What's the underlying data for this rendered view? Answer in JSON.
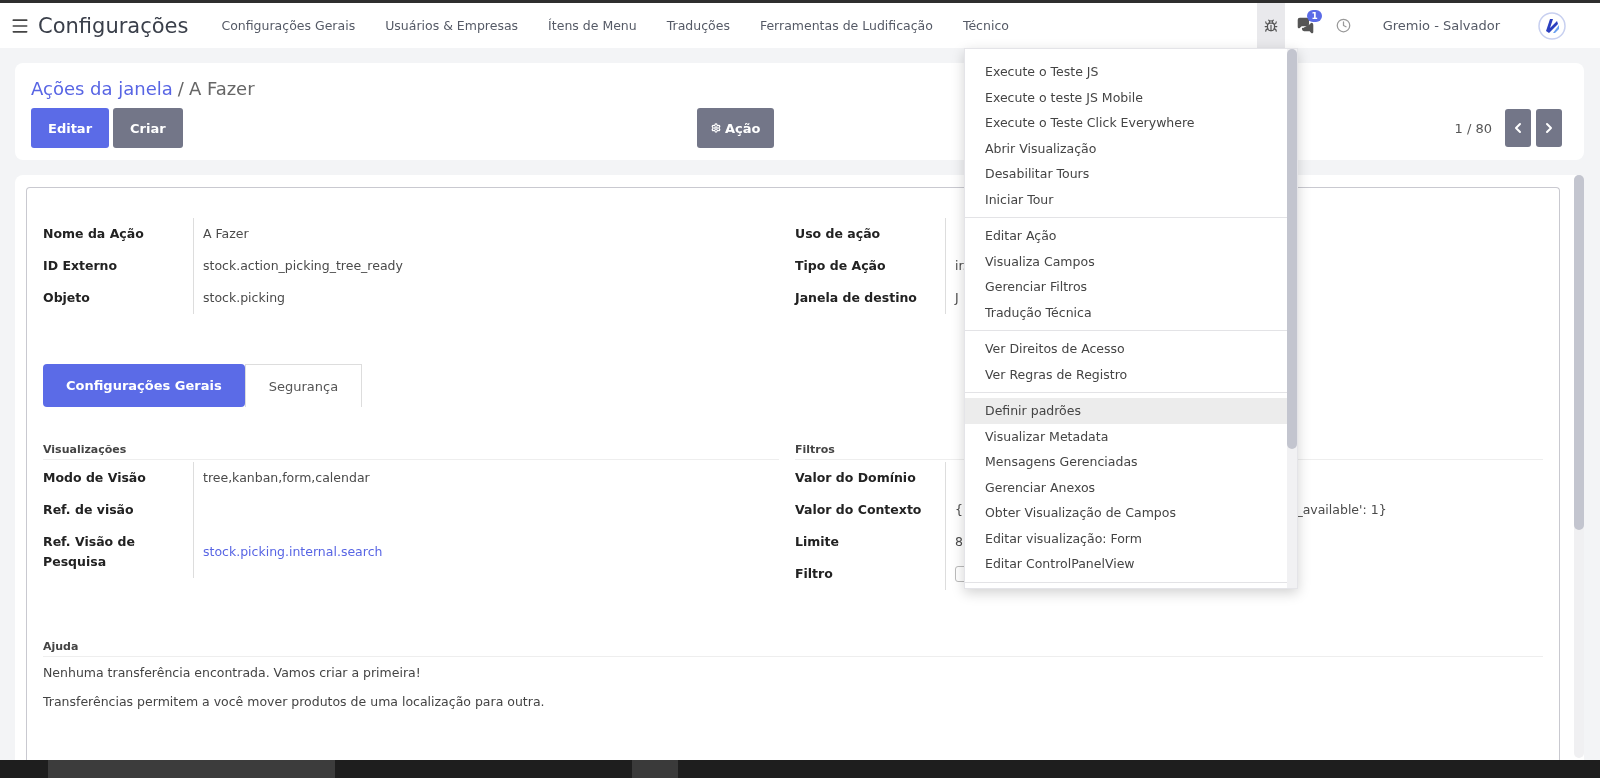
{
  "navbar": {
    "app_title": "Configurações",
    "menu": [
      "Configurações Gerais",
      "Usuários & Empresas",
      "Ítens de Menu",
      "Traduções",
      "Ferramentas de Ludificação",
      "Técnico"
    ],
    "debug_menu_open": true,
    "messages_badge": "1",
    "user": "Gremio - Salvador"
  },
  "control_panel": {
    "breadcrumb": [
      {
        "label": "Ações da janela",
        "link": true
      },
      {
        "label": "A Fazer",
        "link": false
      }
    ],
    "separator": "/",
    "buttons": [
      {
        "label": "Editar",
        "kind": "primary"
      },
      {
        "label": "Criar",
        "kind": "secondary"
      }
    ],
    "action_button": "Ação",
    "pager": "1 / 80"
  },
  "form": {
    "top_left": [
      {
        "label": "Nome da Ação",
        "value": "A Fazer",
        "kind": "text"
      },
      {
        "label": "ID Externo",
        "value": "stock.action_picking_tree_ready",
        "kind": "text"
      },
      {
        "label": "Objeto",
        "value": "stock.picking",
        "kind": "text"
      }
    ],
    "top_right": [
      {
        "label": "Uso de ação",
        "kind": "empty"
      },
      {
        "label": "Tipo de Ação",
        "value": "ir.",
        "kind": "text"
      },
      {
        "label": "Janela de destino",
        "value": "J",
        "kind": "text"
      }
    ],
    "tabs": [
      {
        "label": "Configurações Gerais",
        "selected": true
      },
      {
        "label": "Segurança",
        "selected": false
      }
    ],
    "sections": [
      {
        "title": "Visualizações",
        "fields": [
          {
            "label": "Modo de Visão",
            "value": "tree,kanban,form,calendar",
            "kind": "text"
          },
          {
            "label": "Ref. de visão",
            "kind": "empty"
          },
          {
            "label": "Ref. Visão de Pesquisa",
            "value": "stock.picking.internal.search",
            "kind": "link"
          }
        ]
      },
      {
        "title": "Filtros",
        "fields": [
          {
            "label": "Valor do Domínio",
            "kind": "empty"
          },
          {
            "label": "Valor do Contexto",
            "kind": "split",
            "value_parts": [
              "{'",
              "_available': 1}"
            ]
          },
          {
            "label": "Limite",
            "value": "8",
            "kind": "text"
          },
          {
            "label": "Filtro",
            "kind": "checkbox",
            "checked": false
          }
        ]
      }
    ],
    "help": {
      "title": "Ajuda",
      "paragraphs": [
        "Nenhuma transferência encontrada. Vamos criar a primeira!",
        "Transferências permitem a você mover produtos de uma localização para outra."
      ]
    }
  },
  "debug_menu": {
    "groups": [
      [
        {
          "label": "Execute o Teste JS",
          "highlighted": false
        },
        {
          "label": "Execute o teste JS Mobile",
          "highlighted": false
        },
        {
          "label": "Execute o Teste Click Everywhere",
          "highlighted": false
        },
        {
          "label": "Abrir Visualização",
          "highlighted": false
        },
        {
          "label": "Desabilitar Tours",
          "highlighted": false
        },
        {
          "label": "Iniciar Tour",
          "highlighted": false
        }
      ],
      [
        {
          "label": "Editar Ação",
          "highlighted": false
        },
        {
          "label": "Visualiza Campos",
          "highlighted": false
        },
        {
          "label": "Gerenciar Filtros",
          "highlighted": false
        },
        {
          "label": "Tradução Técnica",
          "highlighted": false
        }
      ],
      [
        {
          "label": "Ver Direitos de Acesso",
          "highlighted": false
        },
        {
          "label": "Ver Regras de Registro",
          "highlighted": false
        }
      ],
      [
        {
          "label": "Definir padrões",
          "highlighted": true
        },
        {
          "label": "Visualizar Metadata",
          "highlighted": false
        },
        {
          "label": "Mensagens Gerenciadas",
          "highlighted": false
        },
        {
          "label": "Gerenciar Anexos",
          "highlighted": false
        },
        {
          "label": "Obter Visualização de Campos",
          "highlighted": false
        },
        {
          "label": "Editar visualização: Form",
          "highlighted": false
        },
        {
          "label": "Editar ControlPanelView",
          "highlighted": false
        }
      ]
    ]
  }
}
